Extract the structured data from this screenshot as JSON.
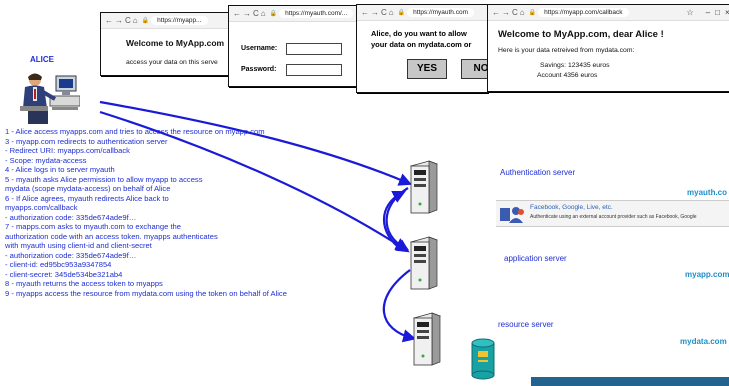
{
  "actor": {
    "name": "ALICE"
  },
  "windows": {
    "w1": {
      "url": "https://myapp...",
      "title": "Welcome to MyApp.com",
      "text": "access your data on this serve"
    },
    "w2": {
      "url": "https://myauth.com/...",
      "username_label": "Username:",
      "password_label": "Password:"
    },
    "w3": {
      "url": "https://myauth.com",
      "question_line1": "Alice, do you want to allow",
      "question_line2": "your data on mydata.com or",
      "yes_label": "YES",
      "no_label": "NO"
    },
    "w4": {
      "url": "https://myapp.com/callback",
      "title": "Welcome to MyApp.com, dear Alice !",
      "intro": "Here is your data retreived from mydata.com:",
      "line1": "Savings: 123435 euros",
      "line2": "Account 4356 euros"
    }
  },
  "steps": [
    [
      "1 - Alice access myapps.com and tries to access the resource on myapp.com"
    ],
    [
      "3 - myapp.com redirects to authentication server",
      "- Redirect URI: myapps.com/callback",
      "- Scope: mydata-access"
    ],
    [
      "4 - Alice logs in to server myauth"
    ],
    [
      "5 - myauth asks Alice permission to allow myapp to access",
      "mydata (scope mydata-access) on behalf of Alice"
    ],
    [
      "6 - If Alice agrees, myauth redirects Alice back to",
      "myapps.com/callback",
      "- authorization code: 335de674ade9f…"
    ],
    [
      "7 - mapps.com asks to myauth.com to exchange the",
      "authorization code with an access token. myapps authenticates",
      "with myauth using client-id and client-secret",
      "- authorization code: 335de674ade9f…",
      "- client-id: ed95bc953a9347854",
      "- client-secret: 345de534be321ab4"
    ],
    [
      "8 - myauth returns the access token to myapps"
    ],
    [
      "9 - myapps access the resource from mydata.com using the token on behalf of Alice"
    ]
  ],
  "servers": {
    "auth": {
      "label": "Authentication server",
      "domain": "myauth.co"
    },
    "app": {
      "label": "application server",
      "domain": "myapp.com"
    },
    "resource": {
      "label": "resource server",
      "domain": "mydata.com"
    }
  },
  "external_provider": {
    "title": "Facebook, Google, Live, etc.",
    "subtitle": "Authenticate using an external account provider such as Facebook, Google"
  }
}
